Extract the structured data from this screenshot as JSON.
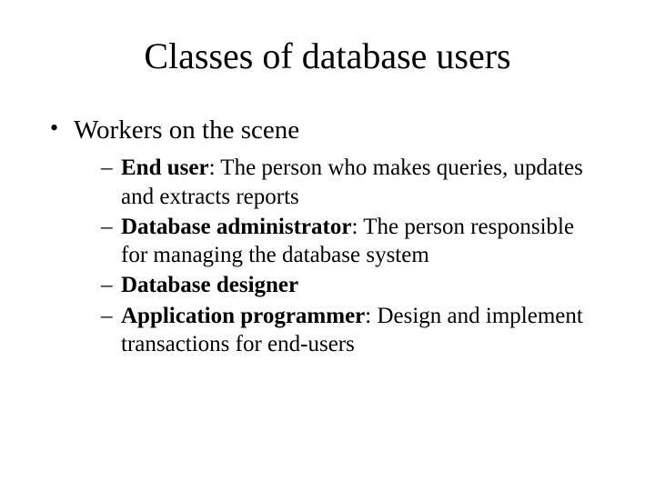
{
  "title": "Classes of database users",
  "bullets": [
    {
      "text": "Workers on the scene",
      "sub": [
        {
          "term": "End user",
          "rest": ": The person who makes queries, updates and extracts reports"
        },
        {
          "term": "Database administrator",
          "rest": ": The person responsible for managing the database system"
        },
        {
          "term": "Database designer",
          "rest": ""
        },
        {
          "term": "Application programmer",
          "rest": ": Design and implement transactions for end-users"
        }
      ]
    }
  ]
}
